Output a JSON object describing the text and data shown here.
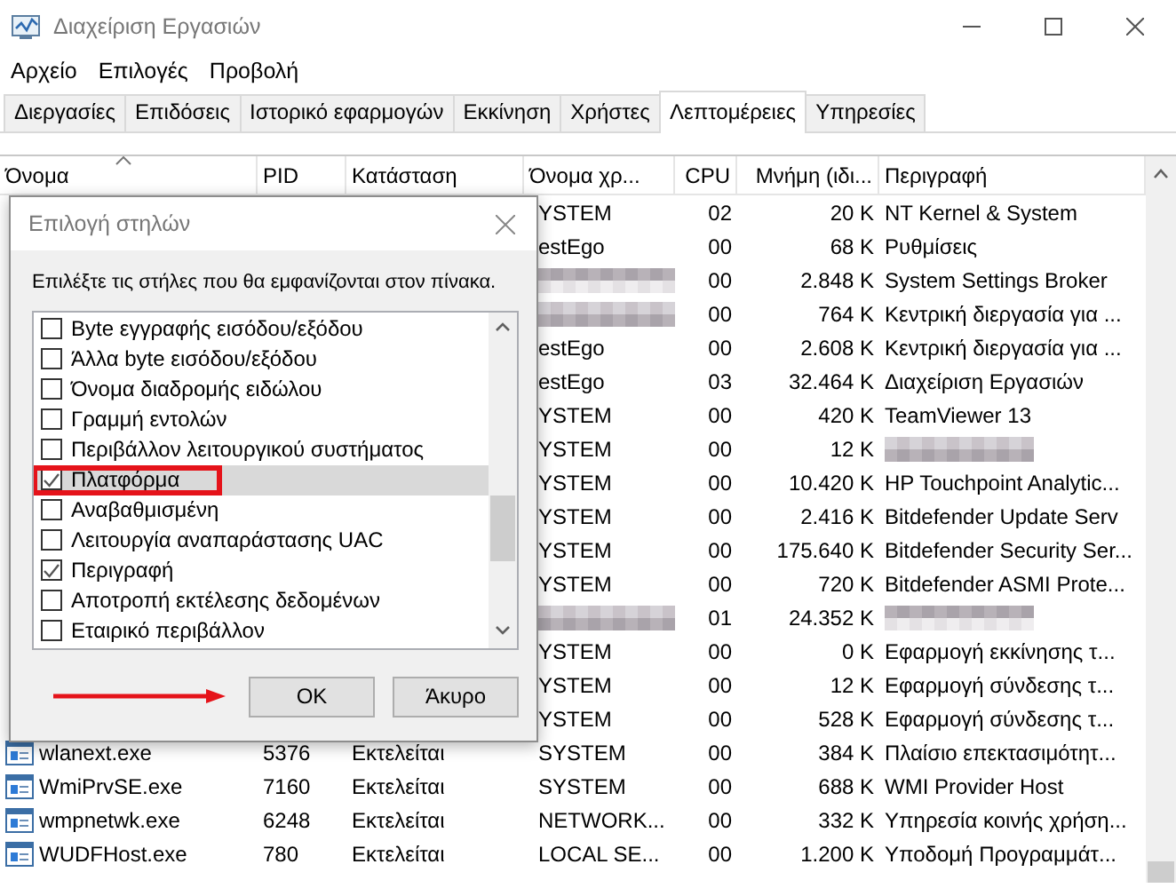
{
  "window": {
    "title": "Διαχείριση Εργασιών"
  },
  "menu": [
    "Αρχείο",
    "Επιλογές",
    "Προβολή"
  ],
  "tabs": [
    {
      "label": "Διεργασίες",
      "selected": false
    },
    {
      "label": "Επιδόσεις",
      "selected": false
    },
    {
      "label": "Ιστορικό εφαρμογών",
      "selected": false
    },
    {
      "label": "Εκκίνηση",
      "selected": false
    },
    {
      "label": "Χρήστες",
      "selected": false
    },
    {
      "label": "Λεπτομέρειες",
      "selected": true
    },
    {
      "label": "Υπηρεσίες",
      "selected": false
    }
  ],
  "table": {
    "columns": [
      {
        "label": "Όνομα",
        "sorted": true
      },
      {
        "label": "PID",
        "sorted": false
      },
      {
        "label": "Κατάσταση",
        "sorted": false
      },
      {
        "label": "Όνομα χρ...",
        "sorted": false
      },
      {
        "label": "CPU",
        "sorted": false
      },
      {
        "label": "Μνήμη (ιδι...",
        "sorted": false
      },
      {
        "label": "Περιγραφή",
        "sorted": false
      }
    ],
    "rows": [
      {
        "user": "YSTEM",
        "cpu": "02",
        "memory": "20 K",
        "description": "NT Kernel & System"
      },
      {
        "user": "estEgo",
        "cpu": "00",
        "memory": "68 K",
        "description": "Ρυθμίσεις"
      },
      {
        "user_blurred": true,
        "cpu": "00",
        "memory": "2.848 K",
        "description": "System Settings Broker"
      },
      {
        "user_blurred": true,
        "cpu": "00",
        "memory": "764 K",
        "description": "Κεντρική διεργασία για ..."
      },
      {
        "user": "estEgo",
        "cpu": "00",
        "memory": "2.608 K",
        "description": "Κεντρική διεργασία για ..."
      },
      {
        "user": "estEgo",
        "cpu": "03",
        "memory": "32.464 K",
        "description": "Διαχείριση Εργασιών"
      },
      {
        "user": "YSTEM",
        "cpu": "00",
        "memory": "420 K",
        "description": "TeamViewer 13"
      },
      {
        "user": "YSTEM",
        "cpu": "00",
        "memory": "12 K",
        "description_blurred": true
      },
      {
        "user": "YSTEM",
        "cpu": "00",
        "memory": "10.420 K",
        "description": "HP Touchpoint Analytic..."
      },
      {
        "user": "YSTEM",
        "cpu": "00",
        "memory": "2.416 K",
        "description": "Bitdefender Update Serv"
      },
      {
        "user": "YSTEM",
        "cpu": "00",
        "memory": "175.640 K",
        "description": "Bitdefender Security Ser..."
      },
      {
        "user": "YSTEM",
        "cpu": "00",
        "memory": "720 K",
        "description": "Bitdefender ASMI Prote..."
      },
      {
        "user_blurred": true,
        "cpu": "01",
        "memory": "24.352 K",
        "description_blurred": true
      },
      {
        "user": "YSTEM",
        "cpu": "00",
        "memory": "0 K",
        "description": "Εφαρμογή εκκίνησης τ..."
      },
      {
        "user": "YSTEM",
        "cpu": "00",
        "memory": "12 K",
        "description": "Εφαρμογή σύνδεσης τ..."
      },
      {
        "user": "YSTEM",
        "cpu": "00",
        "memory": "528 K",
        "description": "Εφαρμογή σύνδεσης τ..."
      },
      {
        "name": "wlanext.exe",
        "pid": "5376",
        "status": "Εκτελείται",
        "user": "SYSTEM",
        "cpu": "00",
        "memory": "384 K",
        "description": "Πλαίσιο επεκτασιμότητ..."
      },
      {
        "name": "WmiPrvSE.exe",
        "pid": "7160",
        "status": "Εκτελείται",
        "user": "SYSTEM",
        "cpu": "00",
        "memory": "688 K",
        "description": "WMI Provider Host"
      },
      {
        "name": "wmpnetwk.exe",
        "pid": "6248",
        "status": "Εκτελείται",
        "user": "NETWORK...",
        "cpu": "00",
        "memory": "332 K",
        "description": "Υπηρεσία κοινής χρήση..."
      },
      {
        "name": "WUDFHost.exe",
        "pid": "780",
        "status": "Εκτελείται",
        "user": "LOCAL SE...",
        "cpu": "00",
        "memory": "1.200 K",
        "description": "Υποδομή Προγραμμάτ..."
      }
    ]
  },
  "dialog": {
    "title": "Επιλογή στηλών",
    "prompt": "Επιλέξτε τις στήλες που θα εμφανίζονται στον πίνακα.",
    "items": [
      {
        "label": "Byte εγγραφής εισόδου/εξόδου",
        "checked": false,
        "selected": false,
        "highlighted": false
      },
      {
        "label": "Άλλα byte εισόδου/εξόδου",
        "checked": false,
        "selected": false,
        "highlighted": false
      },
      {
        "label": "Όνομα διαδρομής ειδώλου",
        "checked": false,
        "selected": false,
        "highlighted": false
      },
      {
        "label": "Γραμμή εντολών",
        "checked": false,
        "selected": false,
        "highlighted": false
      },
      {
        "label": "Περιβάλλον λειτουργικού συστήματος",
        "checked": false,
        "selected": false,
        "highlighted": false
      },
      {
        "label": "Πλατφόρμα",
        "checked": true,
        "selected": true,
        "highlighted": true
      },
      {
        "label": "Αναβαθμισμένη",
        "checked": false,
        "selected": false,
        "highlighted": false
      },
      {
        "label": "Λειτουργία αναπαράστασης UAC",
        "checked": false,
        "selected": false,
        "highlighted": false
      },
      {
        "label": "Περιγραφή",
        "checked": true,
        "selected": false,
        "highlighted": false
      },
      {
        "label": "Αποτροπή εκτέλεσης δεδομένων",
        "checked": false,
        "selected": false,
        "highlighted": false
      },
      {
        "label": "Εταιρικό περιβάλλον",
        "checked": false,
        "selected": false,
        "highlighted": false
      }
    ],
    "buttons": [
      "OK",
      "Άκυρο"
    ]
  }
}
